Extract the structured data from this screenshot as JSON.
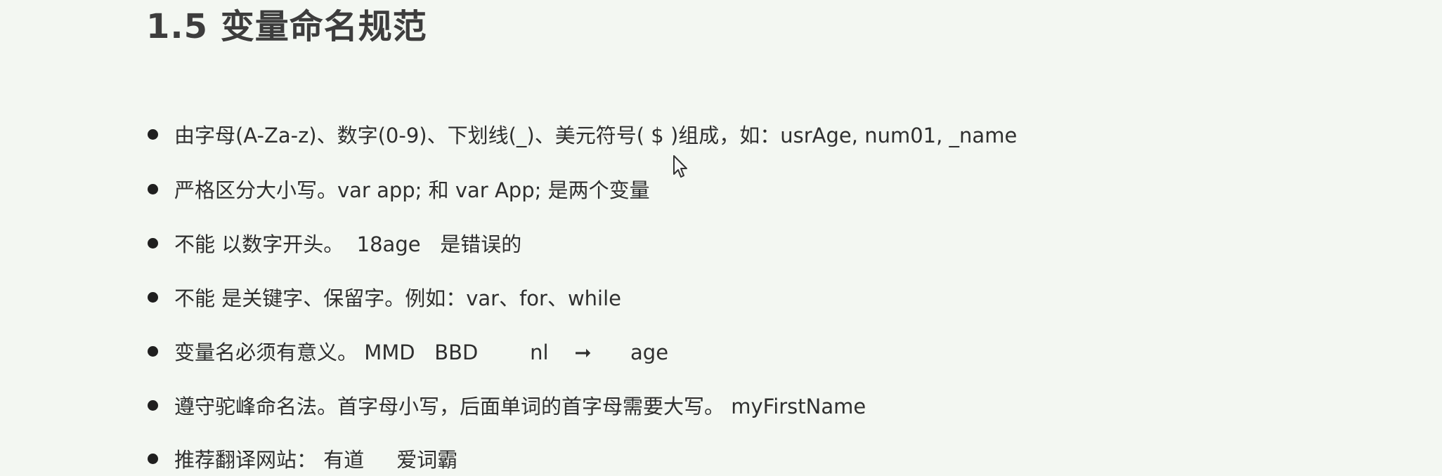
{
  "slide": {
    "title": "1.5 变量命名规范",
    "bullets": [
      {
        "text": "由字母(A-Za-z)、数字(0-9)、下划线(_)、美元符号( $ )组成，如：usrAge, num01, _name"
      },
      {
        "text": "严格区分大小写。var app; 和 var App; 是两个变量"
      },
      {
        "text": "不能 以数字开头。  18age   是错误的"
      },
      {
        "text": "不能 是关键字、保留字。例如：var、for、while"
      },
      {
        "text": "变量名必须有意义。 MMD   BBD        nl    ➞      age"
      },
      {
        "text": "遵守驼峰命名法。首字母小写，后面单词的首字母需要大写。 myFirstName"
      },
      {
        "text": "推荐翻译网站： 有道     爱词霸"
      }
    ]
  },
  "colors": {
    "background": "#f3f7f2",
    "title": "#3d3d3d",
    "text": "#2f2f2f",
    "bullet": "#1f1f1f"
  },
  "icons": {
    "cursor": "mouse-pointer-icon",
    "bullet": "bullet-dot-icon"
  }
}
